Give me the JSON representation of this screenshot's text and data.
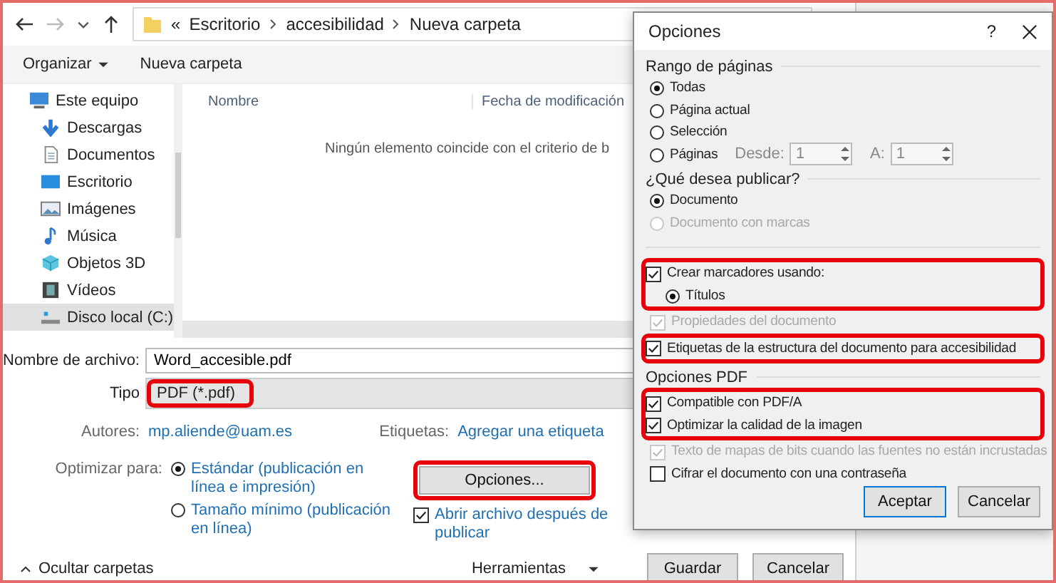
{
  "save_dialog": {
    "address": {
      "overflow": "«",
      "path": [
        "Escritorio",
        "accesibilidad",
        "Nueva carpeta"
      ]
    },
    "toolbar": {
      "organize": "Organizar",
      "new_folder": "Nueva carpeta"
    },
    "sidebar": {
      "items": [
        {
          "label": "Este equipo",
          "kind": "computer",
          "selected": false,
          "children": [
            {
              "label": "Descargas",
              "kind": "download",
              "selected": false
            },
            {
              "label": "Documentos",
              "kind": "document",
              "selected": false
            },
            {
              "label": "Escritorio",
              "kind": "desktop",
              "selected": false
            },
            {
              "label": "Imágenes",
              "kind": "pictures",
              "selected": false
            },
            {
              "label": "Música",
              "kind": "music",
              "selected": false
            },
            {
              "label": "Objetos 3D",
              "kind": "cube",
              "selected": false
            },
            {
              "label": "Vídeos",
              "kind": "video",
              "selected": false
            },
            {
              "label": "Disco local (C:)",
              "kind": "drive",
              "selected": true
            }
          ]
        }
      ]
    },
    "columns": [
      "Nombre",
      "Fecha de modificación"
    ],
    "empty_message": "Ningún elemento coincide con el criterio de b",
    "file_name": {
      "label": "Nombre de archivo:",
      "value": "Word_accesible.pdf"
    },
    "file_type": {
      "label": "Tipo",
      "value": "PDF (*.pdf)",
      "highlighted": true
    },
    "authors": {
      "label": "Autores:",
      "value": "mp.aliende@uam.es"
    },
    "tags": {
      "label": "Etiquetas:",
      "value": "Agregar una etiqueta"
    },
    "optimize": {
      "label": "Optimizar para:",
      "options": [
        {
          "label": "Estándar (publicación en línea e impresión)",
          "selected": true
        },
        {
          "label": "Tamaño mínimo (publicación en línea)",
          "selected": false
        }
      ]
    },
    "options_button": {
      "label": "Opciones...",
      "highlighted": true
    },
    "open_after": {
      "label": "Abrir archivo después de publicar",
      "checked": true
    },
    "hide_folders": "Ocultar carpetas",
    "tools": "Herramientas",
    "buttons": [
      "Guardar",
      "Cancelar"
    ]
  },
  "options_dialog": {
    "title": "Opciones",
    "help": "?",
    "sections": [
      {
        "title": "Rango de páginas",
        "items": [
          {
            "kind": "radio",
            "label": "Todas",
            "selected": true,
            "disabled": false
          },
          {
            "kind": "radio",
            "label": "Página actual",
            "selected": false,
            "disabled": false
          },
          {
            "kind": "radio",
            "label": "Selección",
            "selected": false,
            "disabled": false
          },
          {
            "kind": "range",
            "label": "Páginas",
            "selected": false,
            "disabled": false,
            "from_label": "Desde:",
            "from": "1",
            "to_label": "A:",
            "to": "1"
          }
        ]
      },
      {
        "title": "¿Qué desea publicar?",
        "items": [
          {
            "kind": "radio",
            "label": "Documento",
            "selected": true,
            "disabled": false
          },
          {
            "kind": "radio",
            "label": "Documento con marcas",
            "selected": false,
            "disabled": true
          }
        ]
      },
      {
        "items": [
          {
            "kind": "frame",
            "items": [
              {
                "kind": "checkbox",
                "label": "Crear marcadores usando:",
                "checked": true,
                "disabled": false,
                "children": [
                  {
                    "kind": "radio",
                    "label": "Títulos",
                    "selected": true,
                    "disabled": false
                  }
                ]
              }
            ]
          },
          {
            "kind": "checkbox",
            "label": "Propiedades del documento",
            "checked": true,
            "disabled": true
          },
          {
            "kind": "frame",
            "items": [
              {
                "kind": "checkbox",
                "label": "Etiquetas de la estructura del documento para accesibilidad",
                "checked": true,
                "disabled": false
              }
            ]
          }
        ]
      },
      {
        "title": "Opciones PDF",
        "items": [
          {
            "kind": "frame",
            "items": [
              {
                "kind": "checkbox",
                "label": "Compatible con PDF/A",
                "checked": true,
                "disabled": false
              },
              {
                "kind": "checkbox",
                "label": "Optimizar la calidad de la imagen",
                "checked": true,
                "disabled": false
              }
            ]
          },
          {
            "kind": "checkbox",
            "label": "Texto de mapas de bits cuando las fuentes no están incrustadas",
            "checked": true,
            "disabled": true
          },
          {
            "kind": "checkbox",
            "label": "Cifrar el documento con una contraseña",
            "checked": false,
            "disabled": false
          }
        ]
      }
    ],
    "buttons": [
      "Aceptar",
      "Cancelar"
    ]
  }
}
